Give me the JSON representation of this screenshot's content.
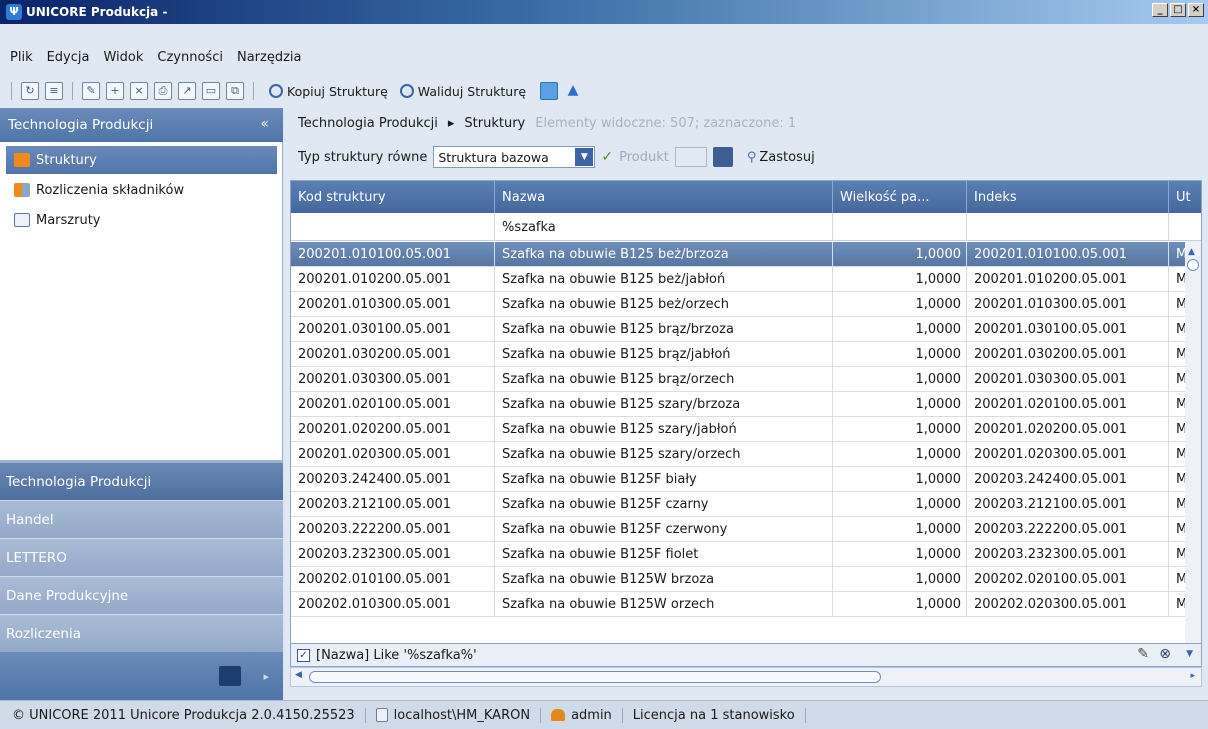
{
  "window": {
    "title": "UNICORE Produkcja -"
  },
  "menu": [
    "Plik",
    "Edycja",
    "Widok",
    "Czynności",
    "Narzędzia"
  ],
  "toolbar": {
    "copy_structure": "Kopiuj Strukturę",
    "validate_structure": "Waliduj Strukturę"
  },
  "left": {
    "header": "Technologia Produkcji",
    "items": [
      "Struktury",
      "Rozliczenia składników",
      "Marszruty"
    ],
    "sections": [
      "Technologia Produkcji",
      "Handel",
      "LETTERO",
      "Dane Produkcyjne",
      "Rozliczenia"
    ]
  },
  "breadcrumb": {
    "root": "Technologia Produkcji",
    "current": "Struktury",
    "info": "Elementy widoczne: 507; zaznaczone: 1"
  },
  "filter": {
    "label": "Typ struktury równe",
    "value": "Struktura bazowa",
    "product_label": "Produkt",
    "apply": "Zastosuj"
  },
  "grid": {
    "columns": [
      "Kod struktury",
      "Nazwa",
      "Wielkość pa...",
      "Indeks",
      "Ut"
    ],
    "filter_text": "%szafka",
    "rows": [
      [
        "200201.010100.05.001",
        "Szafka na obuwie B125 beż/brzoza",
        "1,0000",
        "200201.010100.05.001",
        "M"
      ],
      [
        "200201.010200.05.001",
        "Szafka na obuwie B125 beż/jabłoń",
        "1,0000",
        "200201.010200.05.001",
        "M"
      ],
      [
        "200201.010300.05.001",
        "Szafka na obuwie B125 beż/orzech",
        "1,0000",
        "200201.010300.05.001",
        "M"
      ],
      [
        "200201.030100.05.001",
        "Szafka na obuwie B125 brąz/brzoza",
        "1,0000",
        "200201.030100.05.001",
        "M"
      ],
      [
        "200201.030200.05.001",
        "Szafka na obuwie B125 brąz/jabłoń",
        "1,0000",
        "200201.030200.05.001",
        "M"
      ],
      [
        "200201.030300.05.001",
        "Szafka na obuwie B125 brąz/orzech",
        "1,0000",
        "200201.030300.05.001",
        "M"
      ],
      [
        "200201.020100.05.001",
        "Szafka na obuwie B125 szary/brzoza",
        "1,0000",
        "200201.020100.05.001",
        "M"
      ],
      [
        "200201.020200.05.001",
        "Szafka na obuwie B125 szary/jabłoń",
        "1,0000",
        "200201.020200.05.001",
        "M"
      ],
      [
        "200201.020300.05.001",
        "Szafka na obuwie B125 szary/orzech",
        "1,0000",
        "200201.020300.05.001",
        "M"
      ],
      [
        "200203.242400.05.001",
        "Szafka na obuwie B125F biały",
        "1,0000",
        "200203.242400.05.001",
        "M"
      ],
      [
        "200203.212100.05.001",
        "Szafka na obuwie B125F czarny",
        "1,0000",
        "200203.212100.05.001",
        "M"
      ],
      [
        "200203.222200.05.001",
        "Szafka na obuwie B125F czerwony",
        "1,0000",
        "200203.222200.05.001",
        "M"
      ],
      [
        "200203.232300.05.001",
        "Szafka na obuwie B125F fiolet",
        "1,0000",
        "200203.232300.05.001",
        "M"
      ],
      [
        "200202.010100.05.001",
        "Szafka na obuwie B125W brzoza",
        "1,0000",
        "200202.020100.05.001",
        "M"
      ],
      [
        "200202.010300.05.001",
        "Szafka na obuwie B125W orzech",
        "1,0000",
        "200202.020300.05.001",
        "M"
      ]
    ]
  },
  "filter_expression": "[Nazwa] Like '%szafka%'",
  "status": {
    "copyright": "© UNICORE 2011 Unicore Produkcja 2.0.4150.25523",
    "db": "localhost\\HM_KARON",
    "user": "admin",
    "license": "Licencja na 1 stanowisko"
  }
}
